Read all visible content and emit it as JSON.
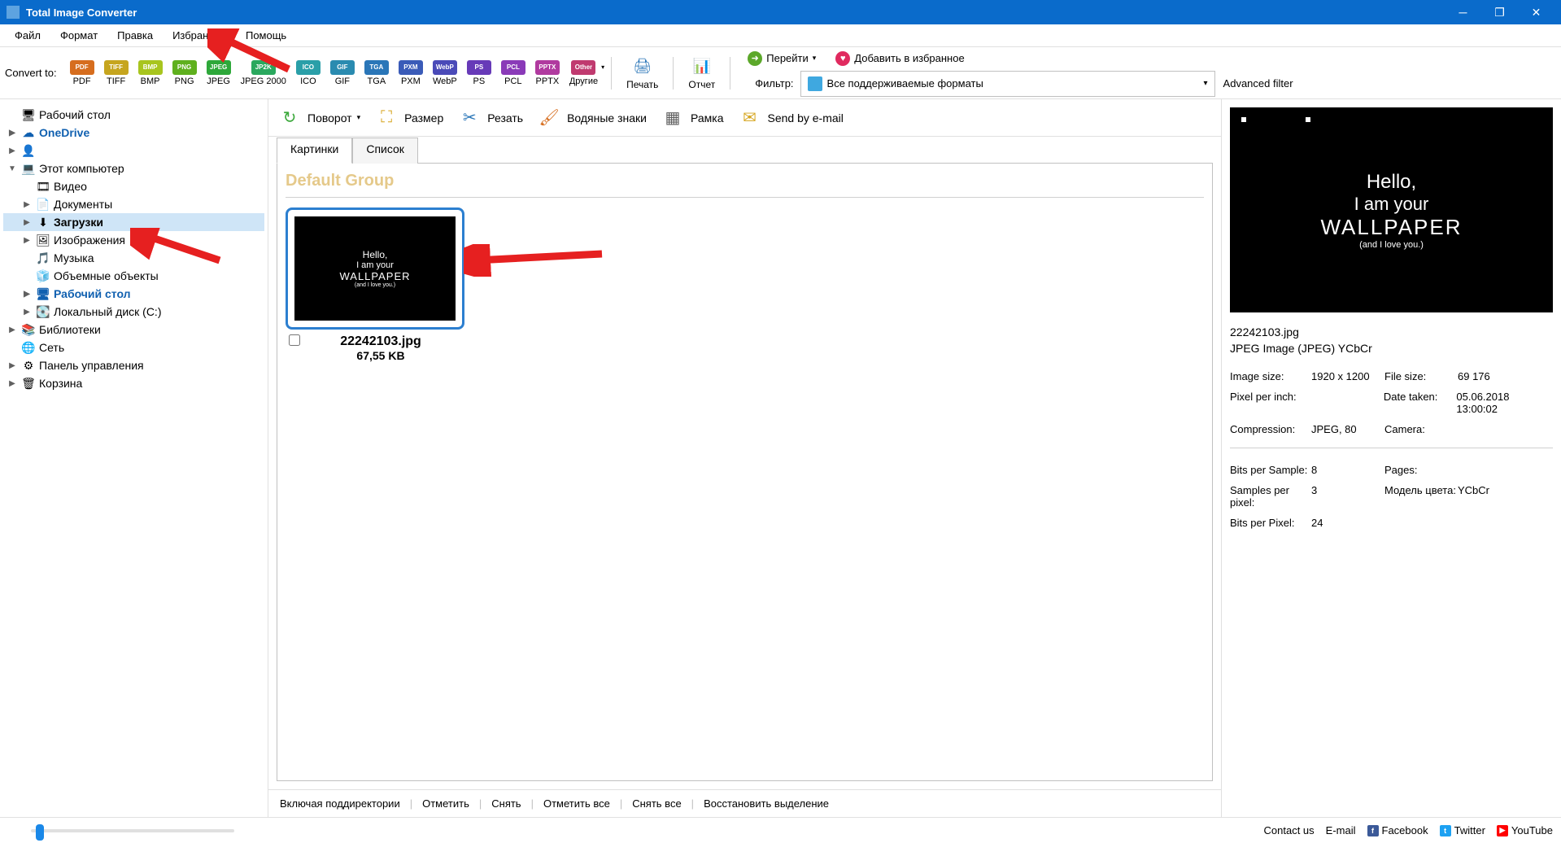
{
  "app_title": "Total Image Converter",
  "menubar": [
    "Файл",
    "Формат",
    "Правка",
    "Избранное",
    "Помощь"
  ],
  "convert_label": "Convert to:",
  "formats": [
    {
      "code": "PDF",
      "label": "PDF",
      "cls": "pdf",
      "dd": false
    },
    {
      "code": "TIFF",
      "label": "TIFF",
      "cls": "tiff",
      "dd": false
    },
    {
      "code": "BMP",
      "label": "BMP",
      "cls": "bmp",
      "dd": false
    },
    {
      "code": "PNG",
      "label": "PNG",
      "cls": "png",
      "dd": false
    },
    {
      "code": "JPEG",
      "label": "JPEG",
      "cls": "jpeg",
      "dd": false
    },
    {
      "code": "JP2K",
      "label": "JPEG 2000",
      "cls": "jp2k",
      "dd": false
    },
    {
      "code": "ICO",
      "label": "ICO",
      "cls": "ico",
      "dd": false
    },
    {
      "code": "GIF",
      "label": "GIF",
      "cls": "gif",
      "dd": false
    },
    {
      "code": "TGA",
      "label": "TGA",
      "cls": "tga",
      "dd": false
    },
    {
      "code": "PXM",
      "label": "PXM",
      "cls": "pxm",
      "dd": false
    },
    {
      "code": "WebP",
      "label": "WebP",
      "cls": "webp",
      "dd": false
    },
    {
      "code": "PS",
      "label": "PS",
      "cls": "ps",
      "dd": false
    },
    {
      "code": "PCL",
      "label": "PCL",
      "cls": "pcl",
      "dd": false
    },
    {
      "code": "PPTX",
      "label": "PPTX",
      "cls": "pptx",
      "dd": false
    },
    {
      "code": "Other",
      "label": "Другие",
      "cls": "other",
      "dd": true
    }
  ],
  "print_label": "Печать",
  "report_label": "Отчет",
  "goto_label": "Перейти",
  "addfav_label": "Добавить в избранное",
  "filter_label": "Фильтр:",
  "filter_value": "Все поддерживаемые форматы",
  "adv_filter_label": "Advanced filter",
  "tree": [
    {
      "label": "Рабочий стол",
      "indent": 0,
      "exp": "",
      "icon": "🖥",
      "blue": false,
      "bold": false,
      "sel": false
    },
    {
      "label": "OneDrive",
      "indent": 0,
      "exp": "▶",
      "icon": "☁",
      "blue": true,
      "bold": true,
      "sel": false
    },
    {
      "label": "",
      "indent": 0,
      "exp": "▶",
      "icon": "👤",
      "blue": false,
      "bold": false,
      "sel": false
    },
    {
      "label": "Этот компьютер",
      "indent": 0,
      "exp": "▼",
      "icon": "💻",
      "blue": false,
      "bold": false,
      "sel": false
    },
    {
      "label": "Видео",
      "indent": 1,
      "exp": "",
      "icon": "🎞",
      "blue": false,
      "bold": false,
      "sel": false
    },
    {
      "label": "Документы",
      "indent": 1,
      "exp": "▶",
      "icon": "📄",
      "blue": false,
      "bold": false,
      "sel": false
    },
    {
      "label": "Загрузки",
      "indent": 1,
      "exp": "▶",
      "icon": "⬇",
      "blue": false,
      "bold": true,
      "sel": true
    },
    {
      "label": "Изображения",
      "indent": 1,
      "exp": "▶",
      "icon": "🖼",
      "blue": false,
      "bold": false,
      "sel": false
    },
    {
      "label": "Музыка",
      "indent": 1,
      "exp": "",
      "icon": "🎵",
      "blue": false,
      "bold": false,
      "sel": false
    },
    {
      "label": "Объемные объекты",
      "indent": 1,
      "exp": "",
      "icon": "🧊",
      "blue": false,
      "bold": false,
      "sel": false
    },
    {
      "label": "Рабочий стол",
      "indent": 1,
      "exp": "▶",
      "icon": "🖥",
      "blue": true,
      "bold": true,
      "sel": false
    },
    {
      "label": "Локальный диск (C:)",
      "indent": 1,
      "exp": "▶",
      "icon": "💽",
      "blue": false,
      "bold": false,
      "sel": false
    },
    {
      "label": "Библиотеки",
      "indent": 0,
      "exp": "▶",
      "icon": "📚",
      "blue": false,
      "bold": false,
      "sel": false
    },
    {
      "label": "Сеть",
      "indent": 0,
      "exp": "",
      "icon": "🌐",
      "blue": false,
      "bold": false,
      "sel": false
    },
    {
      "label": "Панель управления",
      "indent": 0,
      "exp": "▶",
      "icon": "⚙",
      "blue": false,
      "bold": false,
      "sel": false
    },
    {
      "label": "Корзина",
      "indent": 0,
      "exp": "▶",
      "icon": "🗑",
      "blue": false,
      "bold": false,
      "sel": false
    }
  ],
  "actions": [
    {
      "label": "Поворот",
      "icon": "↻",
      "color": "#3aa83a",
      "dd": true
    },
    {
      "label": "Размер",
      "icon": "⛶",
      "color": "#d6a51e",
      "dd": false
    },
    {
      "label": "Резать",
      "icon": "✂",
      "color": "#2a76b8",
      "dd": false
    },
    {
      "label": "Водяные знаки",
      "icon": "🖌",
      "color": "#d66d1e",
      "dd": false
    },
    {
      "label": "Рамка",
      "icon": "▦",
      "color": "#606060",
      "dd": false
    },
    {
      "label": "Send by e-mail",
      "icon": "✉",
      "color": "#d6a51e",
      "dd": false
    }
  ],
  "tabs": [
    {
      "label": "Картинки",
      "active": true
    },
    {
      "label": "Список",
      "active": false
    }
  ],
  "group_title": "Default Group",
  "thumb": {
    "name": "22242103.jpg",
    "size": "67,55 KB",
    "lines": [
      "Hello,",
      "I am your",
      "WALLPAPER",
      "(and I love you.)"
    ]
  },
  "footer_actions": [
    "Включая поддиректории",
    "Отметить",
    "Снять",
    "Отметить все",
    "Снять все",
    "Восстановить выделение"
  ],
  "preview": {
    "filename": "22242103.jpg",
    "type": "JPEG Image (JPEG) YCbCr",
    "lines": [
      "Hello,",
      "I am your",
      "WALLPAPER",
      "(and I love you.)"
    ],
    "rows1": [
      {
        "l1": "Image size:",
        "v1": "1920 x 1200",
        "l2": "File size:",
        "v2": "69 176"
      },
      {
        "l1": "Pixel per inch:",
        "v1": "",
        "l2": "Date taken:",
        "v2": "05.06.2018 13:00:02"
      },
      {
        "l1": "Compression:",
        "v1": "JPEG, 80",
        "l2": "Camera:",
        "v2": ""
      }
    ],
    "rows2": [
      {
        "l1": "Bits per Sample:",
        "v1": "8",
        "l2": "Pages:",
        "v2": ""
      },
      {
        "l1": "Samples per pixel:",
        "v1": "3",
        "l2": "Модель цвета:",
        "v2": "YCbCr"
      },
      {
        "l1": "Bits per Pixel:",
        "v1": "24",
        "l2": "",
        "v2": ""
      }
    ]
  },
  "bottom": {
    "contact": "Contact us",
    "email": "E-mail",
    "facebook": "Facebook",
    "twitter": "Twitter",
    "youtube": "YouTube"
  }
}
